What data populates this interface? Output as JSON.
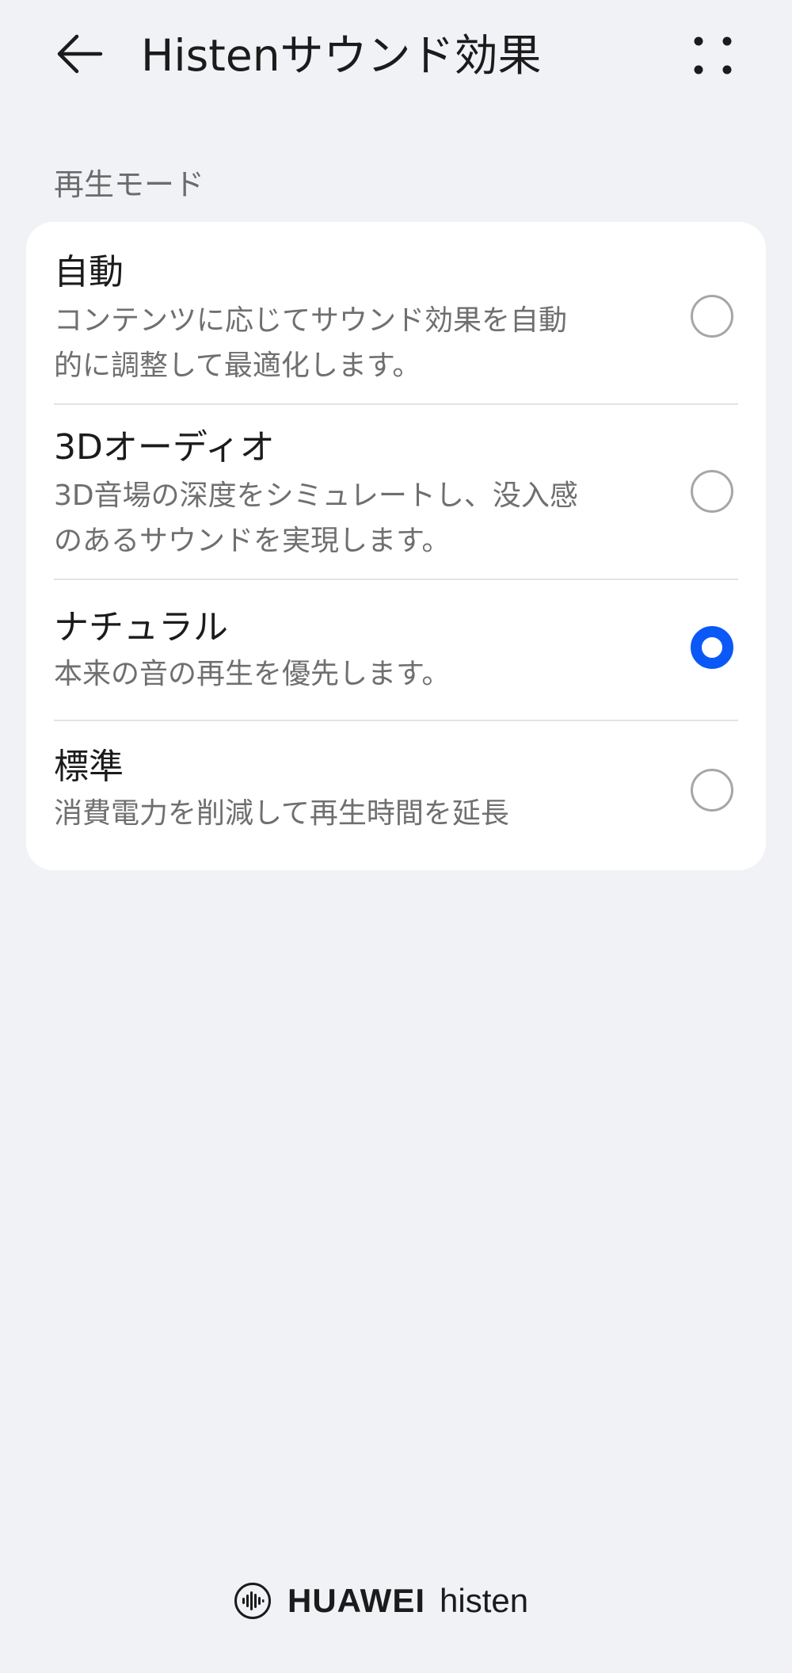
{
  "header": {
    "title": "Histenサウンド効果"
  },
  "section": {
    "label": "再生モード"
  },
  "options": [
    {
      "title": "自動",
      "description_lines": [
        "コンテンツに応じてサウンド効果を自動",
        "的に調整して最適化します。"
      ],
      "selected": false
    },
    {
      "title": "3Dオーディオ",
      "description_lines": [
        "3D音場の深度をシミュレートし、没入感",
        "のあるサウンドを実現します。"
      ],
      "selected": false
    },
    {
      "title": "ナチュラル",
      "description_lines": [
        "本来の音の再生を優先します。"
      ],
      "selected": true
    },
    {
      "title": "標準",
      "description_lines": [
        "消費電力を削減して再生時間を延長"
      ],
      "selected": false
    }
  ],
  "footer": {
    "brand": "HUAWEI",
    "brand_sub": "histen"
  },
  "colors": {
    "accent": "#0a59f7",
    "background": "#f0f2f5",
    "card": "#ffffff"
  },
  "icons": {
    "back": "arrow-left-icon",
    "more": "more-dots-icon",
    "logo": "histen-logo-icon"
  }
}
